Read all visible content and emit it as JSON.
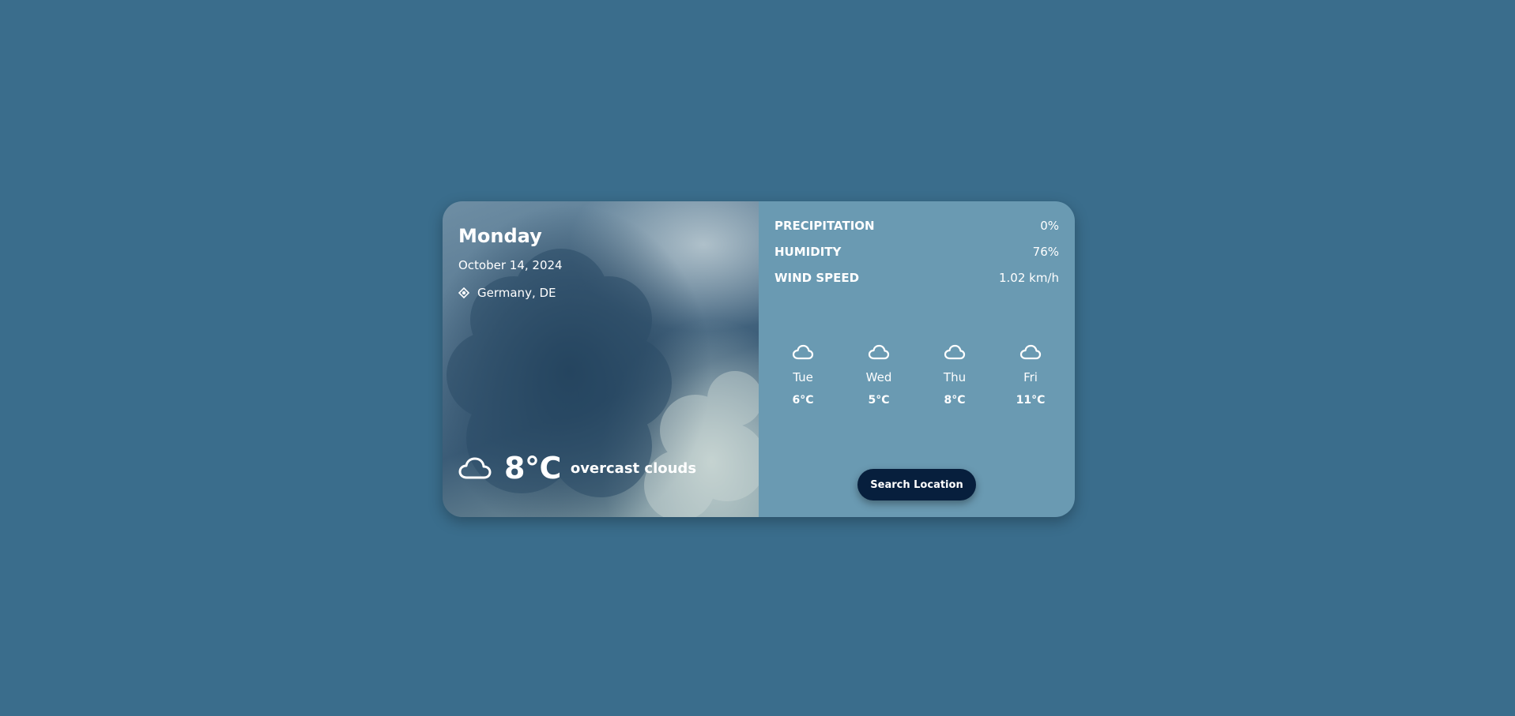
{
  "current": {
    "day": "Monday",
    "date": "October 14, 2024",
    "location": "Germany, DE",
    "location_icon": "location-pin-icon",
    "weather_icon": "cloud-icon",
    "temperature": "8°C",
    "description": "overcast clouds"
  },
  "stats": [
    {
      "label": "PRECIPITATION",
      "value": "0%"
    },
    {
      "label": "HUMIDITY",
      "value": "76%"
    },
    {
      "label": "WIND SPEED",
      "value": "1.02 km/h"
    }
  ],
  "forecast": [
    {
      "day": "Tue",
      "temp": "6°C",
      "icon": "cloud-icon"
    },
    {
      "day": "Wed",
      "temp": "5°C",
      "icon": "cloud-icon"
    },
    {
      "day": "Thu",
      "temp": "8°C",
      "icon": "cloud-icon"
    },
    {
      "day": "Fri",
      "temp": "11°C",
      "icon": "cloud-icon"
    }
  ],
  "search_button_label": "Search Location",
  "colors": {
    "page_background": "#3a6d8c",
    "panel_background": "#6a9ab2",
    "button_background": "#071f3d",
    "text": "#ffffff"
  }
}
